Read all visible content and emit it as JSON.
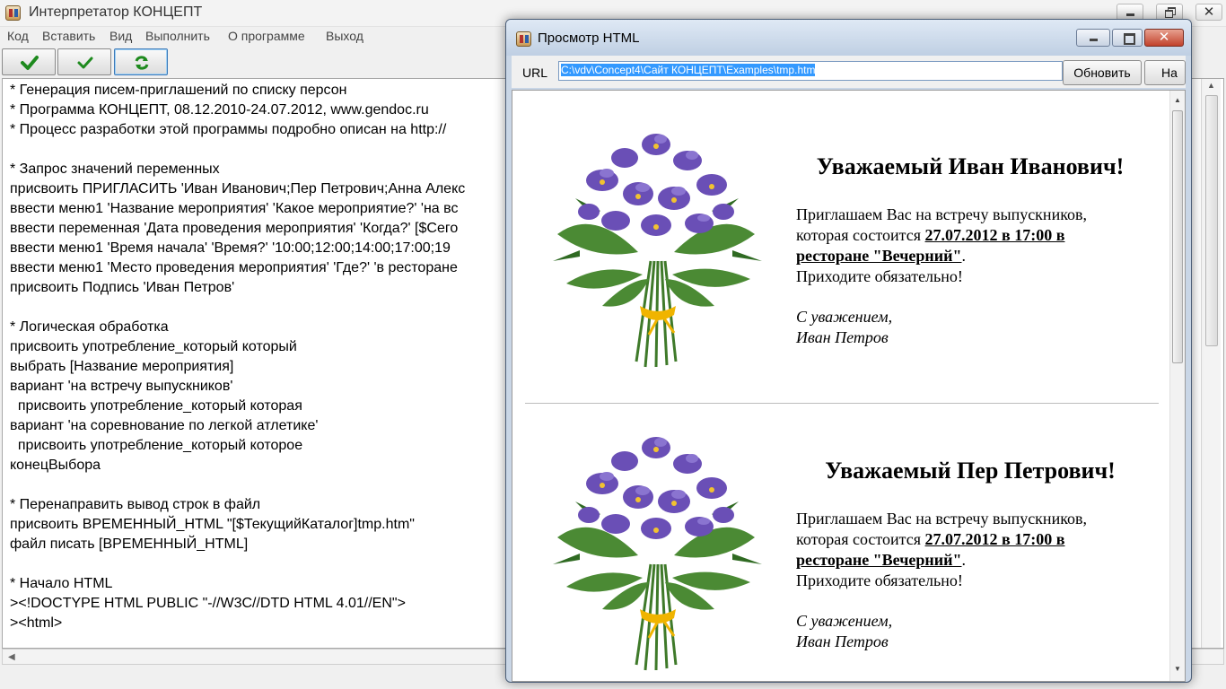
{
  "main_window": {
    "title": "Интерпретатор КОНЦЕПТ",
    "menu": [
      "Код",
      "Вставить",
      "Вид",
      "Выполнить",
      "О программе",
      "Выход"
    ],
    "toolbar": [
      {
        "icon": "green-check-bold-icon"
      },
      {
        "icon": "green-check-icon"
      },
      {
        "icon": "green-refresh-icon"
      }
    ],
    "code_lines": [
      "* Генерация писем-приглашений по списку персон",
      "* Программа КОНЦЕПТ, 08.12.2010-24.07.2012, www.gendoc.ru",
      "* Процесс разработки этой программы подробно описан на http://",
      "",
      "* Запрос значений переменных",
      "присвоить ПРИГЛАСИТЬ 'Иван Иванович;Пер Петрович;Анна Алекс",
      "ввести меню1 'Название мероприятия' 'Какое мероприятие?' 'на вс",
      "ввести переменная 'Дата проведения мероприятия' 'Когда?' [$Сего",
      "ввести меню1 'Время начала' 'Время?' '10:00;12:00;14:00;17:00;19",
      "ввести меню1 'Место проведения мероприятия' 'Где?' 'в ресторане",
      "присвоить Подпись 'Иван Петров'",
      "",
      "* Логическая обработка",
      "присвоить употребление_который который",
      "выбрать [Название мероприятия]",
      "вариант 'на встречу выпускников'",
      "  присвоить употребление_который которая",
      "вариант 'на соревнование по легкой атлетике'",
      "  присвоить употребление_который которое",
      "конецВыбора",
      "",
      "* Перенаправить вывод строк в файл",
      "присвоить ВРЕМЕННЫЙ_HTML \"[$ТекущийКаталог]tmp.htm\"",
      "файл писать [ВРЕМЕННЫЙ_HTML]",
      "",
      "* Начало HTML",
      "><!DOCTYPE HTML PUBLIC \"-//W3C//DTD HTML 4.01//EN\">",
      "><html>"
    ]
  },
  "preview_window": {
    "title": "Просмотр HTML",
    "url_label": "URL",
    "url_value": "C:\\vdv\\Concept4\\Сайт КОНЦЕПТ\\Examples\\tmp.htm",
    "refresh_button": "Обновить",
    "back_button": "На",
    "letters": [
      {
        "greeting": "Уважаемый Иван Иванович!",
        "line1": "Приглашаем Вас на встречу выпускников,",
        "line2_prefix": "которая состоится ",
        "line2_bold": "27.07.2012 в 17:00 в",
        "line3_bold": "ресторане \"Вечерний\"",
        "line3_suffix": ".",
        "line4": "Приходите обязательно!",
        "sign1": "С уважением,",
        "sign2": "Иван Петров"
      },
      {
        "greeting": "Уважаемый Пер Петрович!",
        "line1": "Приглашаем Вас на встречу выпускников,",
        "line2_prefix": "которая состоится ",
        "line2_bold": "27.07.2012 в 17:00 в",
        "line3_bold": "ресторане \"Вечерний\"",
        "line3_suffix": ".",
        "line4": "Приходите обязательно!",
        "sign1": "С уважением,",
        "sign2": "Иван Петров"
      }
    ]
  },
  "colors": {
    "url_selection": "#3399ff",
    "close_button": "#c2422c",
    "iris_petal": "#6a4fb6",
    "leaf_green": "#3f7a2a",
    "ribbon": "#f0b400"
  }
}
